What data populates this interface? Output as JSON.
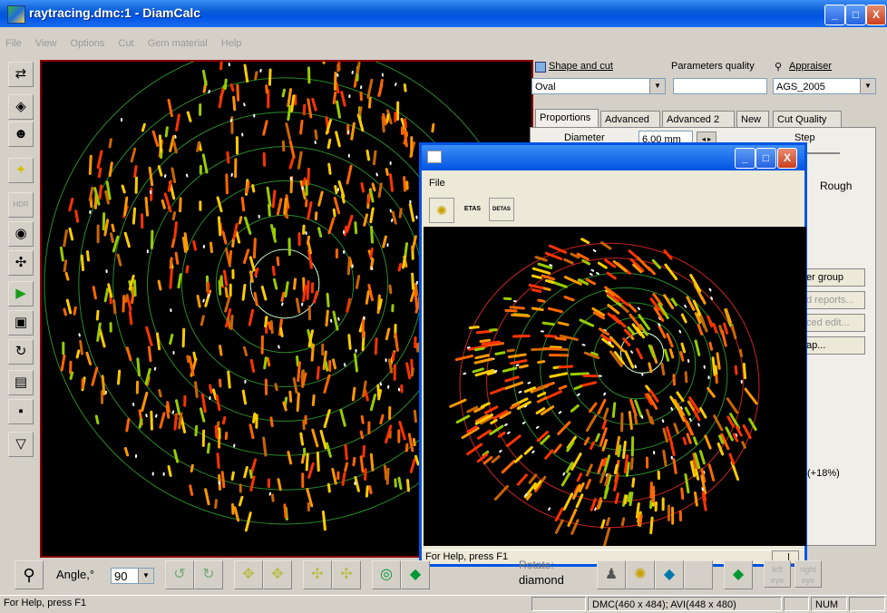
{
  "window": {
    "title": "raytracing.dmc:1 - DiamCalc",
    "buttons": {
      "minimize": "_",
      "maximize": "□",
      "close": "X"
    }
  },
  "menu": [
    "File",
    "View",
    "Options",
    "Cut",
    "Gem material",
    "Help"
  ],
  "vertical_toolbar": [
    {
      "icon": "gem-rotate-icon",
      "glyph": "⇄"
    },
    {
      "icon": "gem-icon",
      "glyph": "◈"
    },
    {
      "icon": "face-icon",
      "glyph": "☻"
    },
    {
      "icon": "light-icon",
      "glyph": "✦"
    },
    {
      "icon": "hdr-icon",
      "glyph": "HDR"
    },
    {
      "icon": "camera-icon",
      "glyph": "◉"
    },
    {
      "icon": "move-icon",
      "glyph": "✣"
    },
    {
      "icon": "play-icon",
      "glyph": "▶"
    },
    {
      "icon": "video-camera-icon",
      "glyph": "▣"
    },
    {
      "icon": "rotate-gem-icon",
      "glyph": "↻"
    },
    {
      "icon": "open-folder-icon",
      "glyph": "▤"
    },
    {
      "icon": "save-disk-icon",
      "glyph": "▪"
    },
    {
      "icon": "bucket-icon",
      "glyph": "▽"
    }
  ],
  "right_panel": {
    "shape_label": "Shape and cut",
    "shape_value": "Oval",
    "quality_label": "Parameters quality",
    "quality_value": "",
    "appraiser_label": "Appraiser",
    "appraiser_value": "AGS_2005",
    "tabs": [
      "Proportions",
      "Advanced",
      "Advanced 2",
      "New",
      "Cut Quality"
    ],
    "diameter_label": "Diameter",
    "diameter_value": "6.00 mm",
    "step_label": "Step",
    "rough_label": "Rough",
    "side_buttons": [
      "er group",
      "d reports...",
      "ced edit...",
      "ap..."
    ],
    "percent_value": "(+18%)"
  },
  "child_window": {
    "menu": "File",
    "tools": [
      {
        "icon": "lightbulb-icon",
        "label": ""
      },
      {
        "icon": "etas-icon",
        "label": "ETAS"
      },
      {
        "icon": "detas-icon",
        "label": "DETAS"
      }
    ],
    "status": "For Help, press F1",
    "status_right": "|"
  },
  "bottom_toolbar": {
    "zoom_icon": "magnifier-icon",
    "angle_label": "Angle,°",
    "angle_value": "90",
    "rotate_label": "Rotate:",
    "rotate_value": "diamond",
    "left_eye": "left eye",
    "right_eye": "right eye"
  },
  "status_bar": {
    "help": "For Help, press F1",
    "dims": "DMC(460 x 484); AVI(448 x 480)",
    "num": "NUM"
  }
}
